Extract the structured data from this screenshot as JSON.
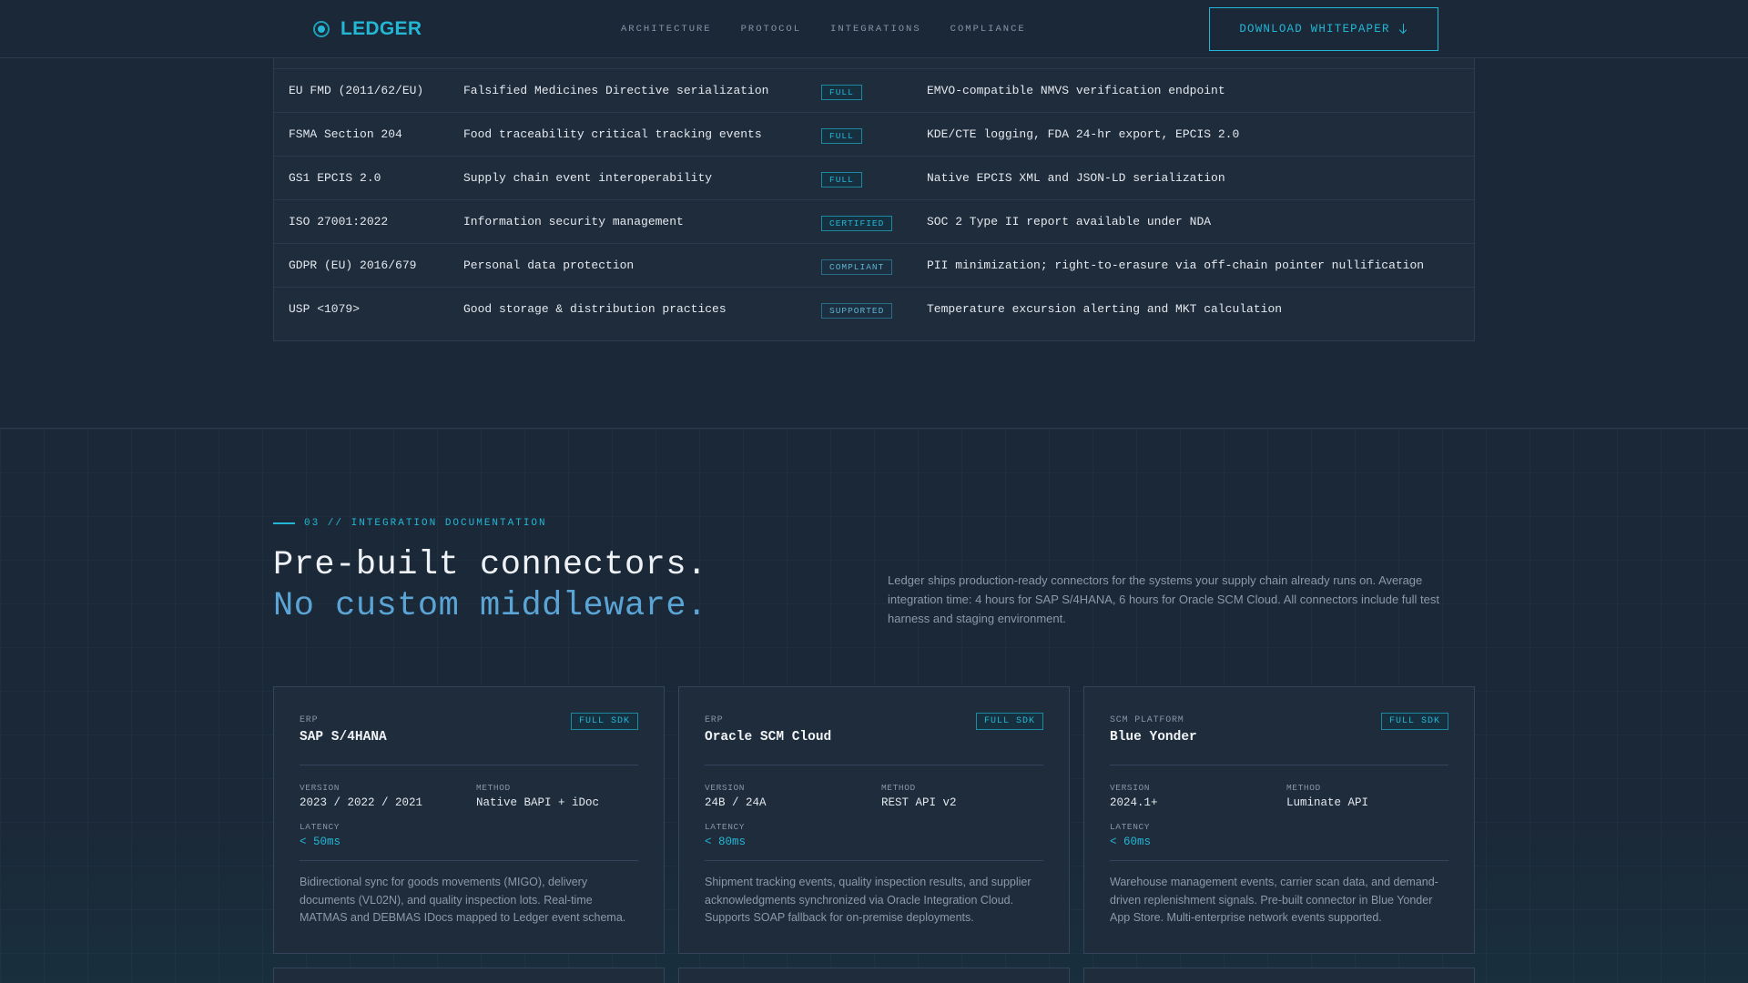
{
  "header": {
    "logo_text": "LEDGER",
    "nav": [
      "ARCHITECTURE",
      "PROTOCOL",
      "INTEGRATIONS",
      "COMPLIANCE"
    ],
    "cta_label": "DOWNLOAD WHITEPAPER"
  },
  "compliance_table": {
    "rows": [
      {
        "standard": "EU FMD (2011/62/EU)",
        "scope": "Falsified Medicines Directive serialization",
        "status": "FULL",
        "notes": "EMVO-compatible NMVS verification endpoint"
      },
      {
        "standard": "FSMA Section 204",
        "scope": "Food traceability critical tracking events",
        "status": "FULL",
        "notes": "KDE/CTE logging, FDA 24-hr export, EPCIS 2.0"
      },
      {
        "standard": "GS1 EPCIS 2.0",
        "scope": "Supply chain event interoperability",
        "status": "FULL",
        "notes": "Native EPCIS XML and JSON-LD serialization"
      },
      {
        "standard": "ISO 27001:2022",
        "scope": "Information security management",
        "status": "CERTIFIED",
        "notes": "SOC 2 Type II report available under NDA"
      },
      {
        "standard": "GDPR (EU) 2016/679",
        "scope": "Personal data protection",
        "status": "COMPLIANT",
        "notes": "PII minimization; right-to-erasure via off-chain pointer nullification"
      },
      {
        "standard": "USP <1079>",
        "scope": "Good storage & distribution practices",
        "status": "SUPPORTED",
        "notes": "Temperature excursion alerting and MKT calculation"
      }
    ]
  },
  "integration": {
    "eyebrow": "03 // INTEGRATION DOCUMENTATION",
    "heading_line1": "Pre-built connectors.",
    "heading_line2": "No custom middleware.",
    "lead": "Ledger ships production-ready connectors for the systems your supply chain already runs on. Average integration time: 4 hours for SAP S/4HANA, 6 hours for Oracle SCM Cloud. All connectors include full test harness and staging environment.",
    "labels": {
      "version": "VERSION",
      "method": "METHOD",
      "latency": "LATENCY"
    },
    "cards": [
      {
        "category": "ERP",
        "title": "SAP S/4HANA",
        "badge": "FULL SDK",
        "version": "2023 / 2022 / 2021",
        "method": "Native BAPI + iDoc",
        "latency": "< 50ms",
        "description": "Bidirectional sync for goods movements (MIGO), delivery documents (VL02N), and quality inspection lots. Real-time MATMAS and DEBMAS IDocs mapped to Ledger event schema."
      },
      {
        "category": "ERP",
        "title": "Oracle SCM Cloud",
        "badge": "FULL SDK",
        "version": "24B / 24A",
        "method": "REST API v2",
        "latency": "< 80ms",
        "description": "Shipment tracking events, quality inspection results, and supplier acknowledgments synchronized via Oracle Integration Cloud. Supports SOAP fallback for on-premise deployments."
      },
      {
        "category": "SCM PLATFORM",
        "title": "Blue Yonder",
        "badge": "FULL SDK",
        "version": "2024.1+",
        "method": "Luminate API",
        "latency": "< 60ms",
        "description": "Warehouse management events, carrier scan data, and demand-driven replenishment signals. Pre-built connector in Blue Yonder App Store. Multi-enterprise network events supported."
      }
    ]
  }
}
